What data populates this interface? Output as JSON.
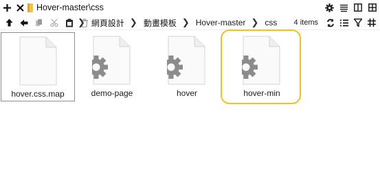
{
  "tab": {
    "title": "Hover-master\\css"
  },
  "tabbar_icons": {
    "new_tab": "plus-icon",
    "close_tab": "close-icon",
    "folder": "folder-icon",
    "settings": "gear-icon",
    "menu": "stack-icon",
    "layout": "single-pane-icon",
    "split": "dual-pane-icon"
  },
  "nav": {
    "breadcrumbs": [
      "網頁設計",
      "動畫模板",
      "Hover-master",
      "css"
    ],
    "item_count": "4 items"
  },
  "files": [
    {
      "name": "hover.css.map",
      "icon": "blank-document-icon",
      "selected": true
    },
    {
      "name": "demo-page",
      "icon": "settings-document-icon",
      "selected": false
    },
    {
      "name": "hover",
      "icon": "settings-document-icon",
      "selected": false
    },
    {
      "name": "hover-min",
      "icon": "settings-document-icon",
      "selected": false,
      "highlighted": true
    }
  ],
  "colors": {
    "highlight": "#f2c21b",
    "selection_border": "#8c8c8c",
    "folder": "#f6c243"
  }
}
